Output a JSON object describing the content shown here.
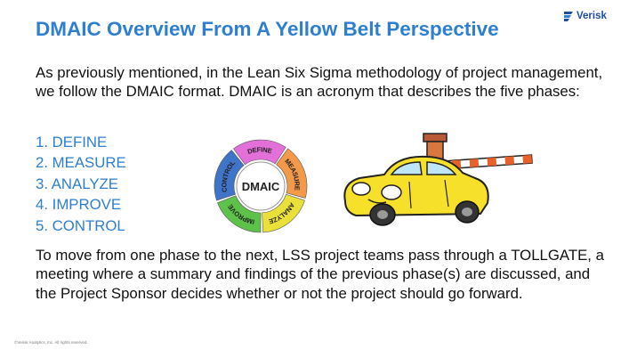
{
  "slide": {
    "title": "DMAIC Overview From A Yellow Belt Perspective",
    "intro": "As previously mentioned, in the Lean Six Sigma methodology of project management, we follow the DMAIC format.  DMAIC is an acronym that describes the five phases:",
    "phases": [
      "1. DEFINE",
      "2. MEASURE",
      "3. ANALYZE",
      "4. IMPROVE",
      "5. CONTROL"
    ],
    "outro": "To move from one phase to the next, LSS project teams pass through a TOLLGATE, a meeting where a summary and findings of the previous phase(s) are discussed, and the Project Sponsor decides whether or not the project should go forward.",
    "footer": "©Verisk Analytics, Inc. All rights reserved."
  },
  "logo": {
    "text": "Verisk",
    "icon": "verisk-logo-mark"
  },
  "dmaic_cycle": {
    "center_label": "DMAIC",
    "segments": [
      {
        "label": "DEFINE",
        "color": "#e36fd8"
      },
      {
        "label": "MEASURE",
        "color": "#f39a4a"
      },
      {
        "label": "ANALYZE",
        "color": "#e9e13a"
      },
      {
        "label": "IMPROVE",
        "color": "#5ec24a"
      },
      {
        "label": "CONTROL",
        "color": "#3f74c9"
      }
    ]
  },
  "illustration": {
    "icon": "car-at-tollgate-icon"
  },
  "colors": {
    "accent": "#2e7fd0",
    "logo": "#1f4ea1",
    "body_text": "#111111"
  }
}
